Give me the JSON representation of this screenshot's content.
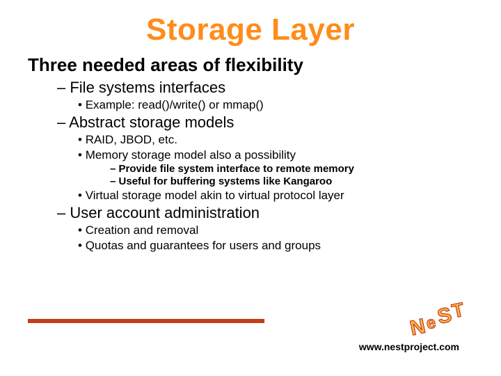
{
  "title": "Storage Layer",
  "heading": "Three needed areas of flexibility",
  "items": [
    {
      "label": "File systems interfaces",
      "sub": [
        {
          "label": "Example: read()/write() or mmap()"
        }
      ]
    },
    {
      "label": "Abstract storage models",
      "sub": [
        {
          "label": "RAID, JBOD, etc."
        },
        {
          "label": "Memory storage model also a possibility",
          "sub": [
            {
              "label": "Provide file system interface to remote memory"
            },
            {
              "label": "Useful for buffering systems like Kangaroo"
            }
          ]
        },
        {
          "label": "Virtual storage model akin to virtual protocol layer"
        }
      ]
    },
    {
      "label": "User account administration",
      "sub": [
        {
          "label": "Creation and removal"
        },
        {
          "label": "Quotas and guarantees for users and groups"
        }
      ]
    }
  ],
  "footer_url": "www.nestproject.com",
  "logo_text": "NeST",
  "colors": {
    "accent": "#ff8c1a",
    "rule": "#c13e1a",
    "logo_fill": "#ffb54a",
    "logo_stroke": "#c13e1a"
  }
}
